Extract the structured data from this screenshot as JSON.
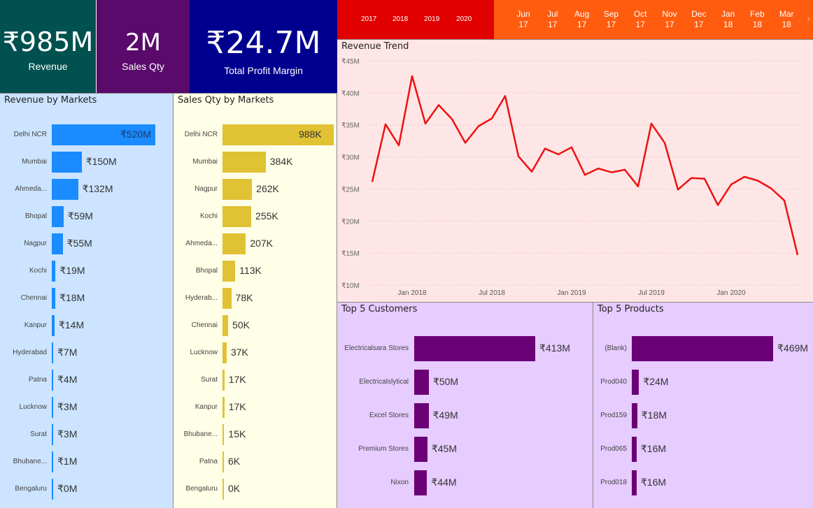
{
  "kpis": {
    "revenue": {
      "value": "₹985M",
      "label": "Revenue"
    },
    "sales_qty": {
      "value": "2M",
      "label": "Sales Qty"
    },
    "profit_margin": {
      "value": "₹24.7M",
      "label": "Total Profit Margin"
    }
  },
  "year_slicer": {
    "years": [
      "2017",
      "2018",
      "2019",
      "2020"
    ],
    "color": "#e00000"
  },
  "month_slicer": {
    "months": [
      {
        "m": "Jun",
        "y": "17"
      },
      {
        "m": "Jul",
        "y": "17"
      },
      {
        "m": "Aug",
        "y": "17"
      },
      {
        "m": "Sep",
        "y": "17"
      },
      {
        "m": "Oct",
        "y": "17"
      },
      {
        "m": "Nov",
        "y": "17"
      },
      {
        "m": "Dec",
        "y": "17"
      },
      {
        "m": "Jan",
        "y": "18"
      },
      {
        "m": "Feb",
        "y": "18"
      },
      {
        "m": "Mar",
        "y": "18"
      }
    ],
    "color": "#ff5c0f"
  },
  "revenue_by_markets": {
    "title": "Revenue by Markets",
    "color": "#1a8cff",
    "items": [
      {
        "label": "Delhi NCR",
        "value": 520,
        "text": "₹520M"
      },
      {
        "label": "Mumbai",
        "value": 150,
        "text": "₹150M"
      },
      {
        "label": "Ahmeda...",
        "value": 132,
        "text": "₹132M"
      },
      {
        "label": "Bhopal",
        "value": 59,
        "text": "₹59M"
      },
      {
        "label": "Nagpur",
        "value": 55,
        "text": "₹55M"
      },
      {
        "label": "Kochi",
        "value": 19,
        "text": "₹19M"
      },
      {
        "label": "Chennai",
        "value": 18,
        "text": "₹18M"
      },
      {
        "label": "Kanpur",
        "value": 14,
        "text": "₹14M"
      },
      {
        "label": "Hyderabad",
        "value": 7,
        "text": "₹7M"
      },
      {
        "label": "Patna",
        "value": 4,
        "text": "₹4M"
      },
      {
        "label": "Lucknow",
        "value": 3,
        "text": "₹3M"
      },
      {
        "label": "Surat",
        "value": 3,
        "text": "₹3M"
      },
      {
        "label": "Bhubane...",
        "value": 1,
        "text": "₹1M"
      },
      {
        "label": "Bengaluru",
        "value": 0,
        "text": "₹0M"
      }
    ]
  },
  "sales_qty_by_markets": {
    "title": "Sales Qty by Markets",
    "color": "#e0c234",
    "items": [
      {
        "label": "Delhi NCR",
        "value": 988,
        "text": "988K"
      },
      {
        "label": "Mumbai",
        "value": 384,
        "text": "384K"
      },
      {
        "label": "Nagpur",
        "value": 262,
        "text": "262K"
      },
      {
        "label": "Kochi",
        "value": 255,
        "text": "255K"
      },
      {
        "label": "Ahmeda...",
        "value": 207,
        "text": "207K"
      },
      {
        "label": "Bhopal",
        "value": 113,
        "text": "113K"
      },
      {
        "label": "Hyderab...",
        "value": 78,
        "text": "78K"
      },
      {
        "label": "Chennai",
        "value": 50,
        "text": "50K"
      },
      {
        "label": "Lucknow",
        "value": 37,
        "text": "37K"
      },
      {
        "label": "Surat",
        "value": 17,
        "text": "17K"
      },
      {
        "label": "Kanpur",
        "value": 17,
        "text": "17K"
      },
      {
        "label": "Bhubane...",
        "value": 15,
        "text": "15K"
      },
      {
        "label": "Patna",
        "value": 6,
        "text": "6K"
      },
      {
        "label": "Bengaluru",
        "value": 0,
        "text": "0K"
      }
    ]
  },
  "top_customers": {
    "title": "Top 5 Customers",
    "color": "#6b0076",
    "items": [
      {
        "label": "Electricalsara Stores",
        "value": 413,
        "text": "₹413M"
      },
      {
        "label": "Electricalslytical",
        "value": 50,
        "text": "₹50M"
      },
      {
        "label": "Excel Stores",
        "value": 49,
        "text": "₹49M"
      },
      {
        "label": "Premium Stores",
        "value": 45,
        "text": "₹45M"
      },
      {
        "label": "Nixon",
        "value": 44,
        "text": "₹44M"
      }
    ]
  },
  "top_products": {
    "title": "Top 5 Products",
    "color": "#6b0076",
    "items": [
      {
        "label": "(Blank)",
        "value": 469,
        "text": "₹469M"
      },
      {
        "label": "Prod040",
        "value": 24,
        "text": "₹24M"
      },
      {
        "label": "Prod159",
        "value": 18,
        "text": "₹18M"
      },
      {
        "label": "Prod065",
        "value": 16,
        "text": "₹16M"
      },
      {
        "label": "Prod018",
        "value": 16,
        "text": "₹16M"
      }
    ]
  },
  "chart_data": {
    "type": "line",
    "title": "Revenue Trend",
    "color": "#ee1111",
    "yticks": [
      "₹10M",
      "₹15M",
      "₹20M",
      "₹25M",
      "₹30M",
      "₹35M",
      "₹40M",
      "₹45M"
    ],
    "xticks": [
      "Jan 2018",
      "Jul 2018",
      "Jan 2019",
      "Jul 2019",
      "Jan 2020"
    ],
    "ylim": [
      10,
      45
    ],
    "x": [
      "2017-10",
      "2017-11",
      "2017-12",
      "2018-01",
      "2018-02",
      "2018-03",
      "2018-04",
      "2018-05",
      "2018-06",
      "2018-07",
      "2018-08",
      "2018-09",
      "2018-10",
      "2018-11",
      "2018-12",
      "2019-01",
      "2019-02",
      "2019-03",
      "2019-04",
      "2019-05",
      "2019-06",
      "2019-07",
      "2019-08",
      "2019-09",
      "2019-10",
      "2019-11",
      "2019-12",
      "2020-01",
      "2020-02",
      "2020-03",
      "2020-04",
      "2020-05",
      "2020-06"
    ],
    "series": [
      {
        "values": [
          26.1,
          35.1,
          31.8,
          42.6,
          35.2,
          38.1,
          35.9,
          32.2,
          34.8,
          36.0,
          39.5,
          30.1,
          27.7,
          31.3,
          30.4,
          31.5,
          27.2,
          28.2,
          27.6,
          28.0,
          25.4,
          35.2,
          32.2,
          24.9,
          26.7,
          26.6,
          22.5,
          25.7,
          26.9,
          26.3,
          25.1,
          23.2,
          14.7
        ]
      }
    ]
  }
}
